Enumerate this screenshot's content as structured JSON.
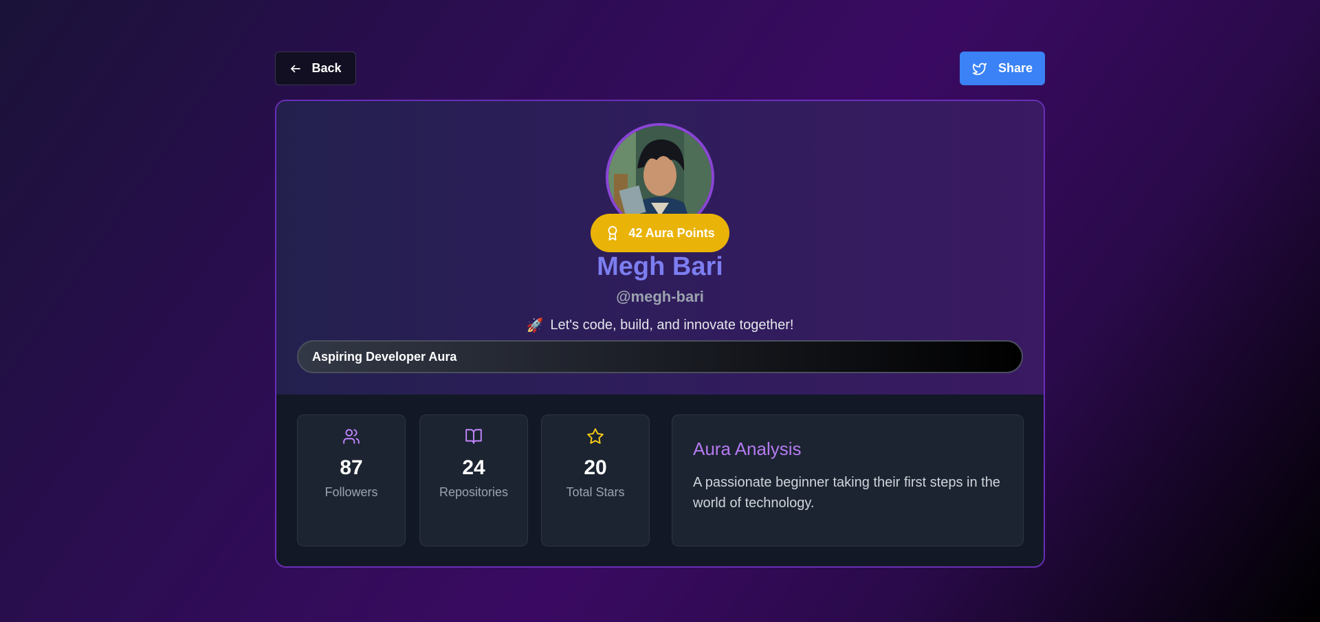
{
  "nav": {
    "back_label": "Back",
    "share_label": "Share"
  },
  "profile": {
    "aura_points_label": "42 Aura Points",
    "name": "Megh Bari",
    "username": "@megh-bari",
    "bio_emoji": "🚀",
    "bio": "Let's code, build, and innovate together!",
    "aura_level": "Aspiring Developer Aura"
  },
  "stats": [
    {
      "icon": "users-icon",
      "value": "87",
      "label": "Followers",
      "color": "#c084fc"
    },
    {
      "icon": "book-open-icon",
      "value": "24",
      "label": "Repositories",
      "color": "#c084fc"
    },
    {
      "icon": "star-icon",
      "value": "20",
      "label": "Total Stars",
      "color": "#facc15"
    }
  ],
  "analysis": {
    "title": "Aura Analysis",
    "text": "A passionate beginner taking their first steps in the world of technology."
  },
  "colors": {
    "accent_purple": "#8b45d6",
    "aura_gold": "#eab308",
    "share_blue": "#3b82f6",
    "name_color": "#7c7ef0"
  }
}
